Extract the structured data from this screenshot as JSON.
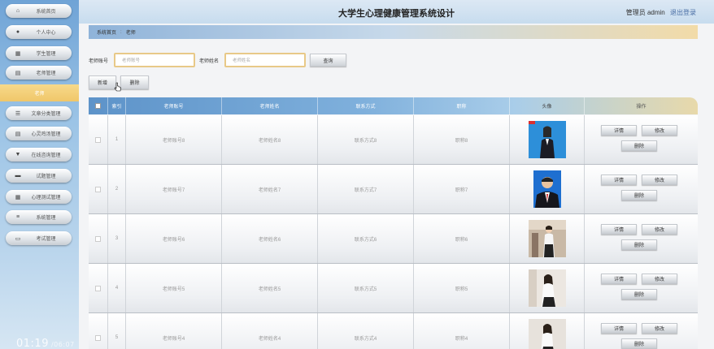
{
  "app": {
    "title": "大学生心理健康管理系统设计",
    "admin_label": "管理员 admin",
    "logout_label": "退出登录"
  },
  "sidebar": {
    "items": [
      {
        "label": "系统首页",
        "icon": "home-icon"
      },
      {
        "label": "个人中心",
        "icon": "user-icon"
      },
      {
        "label": "学生管理",
        "icon": "grid-icon"
      },
      {
        "label": "老师管理",
        "icon": "doc-icon"
      },
      {
        "label": "文章分类管理",
        "icon": "list-icon"
      },
      {
        "label": "心灵鸡汤管理",
        "icon": "doc-icon"
      },
      {
        "label": "在线咨询管理",
        "icon": "chat-icon"
      },
      {
        "label": "试题管理",
        "icon": "monitor-icon"
      },
      {
        "label": "心理测试管理",
        "icon": "grid-icon"
      },
      {
        "label": "系统管理",
        "icon": "menu-icon"
      },
      {
        "label": "考试管理",
        "icon": "keyboard-icon"
      }
    ],
    "active_sub": "老师"
  },
  "breadcrumb": {
    "home": "系统首页",
    "current": "老师"
  },
  "search": {
    "account_label": "老师账号",
    "account_placeholder": "老师账号",
    "name_label": "老师姓名",
    "name_placeholder": "老师姓名",
    "query_button": "查询"
  },
  "toolbar": {
    "add_label": "新增",
    "delete_label": "删除"
  },
  "table": {
    "headers": [
      "索引",
      "老师账号",
      "老师姓名",
      "联系方式",
      "职称",
      "头像",
      "操作"
    ],
    "rows": [
      {
        "index": "1",
        "account": "老师账号8",
        "name": "老师姓名8",
        "contact": "联系方式8",
        "title": "职称8"
      },
      {
        "index": "2",
        "account": "老师账号7",
        "name": "老师姓名7",
        "contact": "联系方式7",
        "title": "职称7"
      },
      {
        "index": "3",
        "account": "老师账号6",
        "name": "老师姓名6",
        "contact": "联系方式6",
        "title": "职称6"
      },
      {
        "index": "4",
        "account": "老师账号5",
        "name": "老师姓名5",
        "contact": "联系方式5",
        "title": "职称5"
      },
      {
        "index": "5",
        "account": "老师账号4",
        "name": "老师姓名4",
        "contact": "联系方式4",
        "title": "职称4"
      }
    ],
    "ops": {
      "detail": "详情",
      "edit": "修改",
      "delete": "删除"
    }
  },
  "video": {
    "current_time": "01:19",
    "total_time": "/06:07"
  },
  "colors": {
    "sidebar_top": "#6fa3d6",
    "active_item": "#f0c76a",
    "header_bg": "#c7dcee",
    "table_header_start": "#5d93c9",
    "search_border": "#e8c988"
  }
}
